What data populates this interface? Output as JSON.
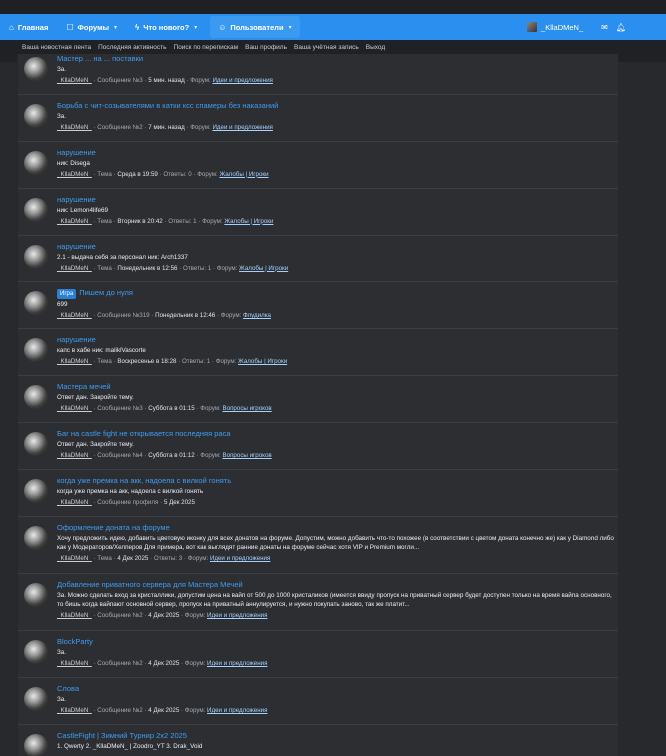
{
  "nav": {
    "home": "Главная",
    "forums": "Форумы",
    "whats_new": "Что нового?",
    "users": "Пользователи",
    "username": "_KllaDMeN_"
  },
  "icons": {
    "home": "home-icon",
    "forums": "forums-icon",
    "whats_new": "whats-new-icon",
    "users": "users-icon",
    "mail": "mail-icon",
    "bell": "bell-icon"
  },
  "subnav": [
    "Ваша новостная лента",
    "Последняя активность",
    "Поиск по перепискам",
    "Ваш профиль",
    "Ваша учётная запись",
    "Выход"
  ],
  "results": [
    {
      "title": "Мастер ... на ... поставки",
      "badge": "",
      "snippet": "За.",
      "author": "_KllaDMeN_",
      "type": "Сообщение №3",
      "date": "5 мин. назад",
      "answers": "",
      "forum": "Идеи и предложения"
    },
    {
      "title": "Борьба с чит-созывателями в катки ксс спамеры без наказаний",
      "badge": "",
      "snippet": "За.",
      "author": "_KllaDMeN_",
      "type": "Сообщение №2",
      "date": "7 мин. назад",
      "answers": "",
      "forum": "Идеи и предложения"
    },
    {
      "title": "нарушение",
      "badge": "",
      "snippet": "ник: Disega",
      "author": "_KllaDMeN_",
      "type": "Тема",
      "date": "Среда в 19:59",
      "answers": "Ответы: 0",
      "forum": "Жалобы | Игроки"
    },
    {
      "title": "нарушение",
      "badge": "",
      "snippet": "ник: Lemon4life69",
      "author": "_KllaDMeN_",
      "type": "Тема",
      "date": "Вторник в 20:42",
      "answers": "Ответы: 1",
      "forum": "Жалобы | Игроки"
    },
    {
      "title": "нарушение",
      "badge": "",
      "snippet": "2.1 - выдача себя за персонал ник: Arch1337",
      "author": "_KllaDMeN_",
      "type": "Тема",
      "date": "Понедельник в 12:56",
      "answers": "Ответы: 1",
      "forum": "Жалобы | Игроки"
    },
    {
      "title": "Пишем до нуля",
      "badge": "Игра",
      "snippet": "699",
      "author": "_KllaDMeN_",
      "type": "Сообщение №319",
      "date": "Понедельник в 12:46",
      "answers": "",
      "forum": "Флудилка"
    },
    {
      "title": "нарушение",
      "badge": "",
      "snippet": "капс в хабе ник: maliklVascorte",
      "author": "_KllaDMeN_",
      "type": "Тема",
      "date": "Воскресенье в 18:28",
      "answers": "Ответы: 1",
      "forum": "Жалобы | Игроки"
    },
    {
      "title": "Мастера мечей",
      "badge": "",
      "snippet": "Ответ дан. Закройте тему.",
      "author": "_KllaDMeN_",
      "type": "Сообщение №3",
      "date": "Суббота в 01:15",
      "answers": "",
      "forum": "Вопросы игроков"
    },
    {
      "title": "Баг на castle fight не открывается последняя раса",
      "badge": "",
      "snippet": "Ответ дан. Закройте тему.",
      "author": "_KllaDMeN_",
      "type": "Сообщение №4",
      "date": "Суббота в 01:12",
      "answers": "",
      "forum": "Вопросы игроков"
    },
    {
      "title": "когда уже премка на акк, надоела с вилкой гонять",
      "badge": "",
      "snippet": "когда уже премка на акк, надоела с вилкой гонять",
      "author": "_KllaDMeN_",
      "type": "Сообщение профиля",
      "date": "5 Дек 2025",
      "answers": "",
      "forum": ""
    },
    {
      "title": "Оформление доната на форуме",
      "badge": "",
      "snippet": "Хочу предложить идею, добавить цветовую иконку для всех донатов на форуме. Допустим, можно добавить что-то похожее (в соответствии с цветом доната конечно же) как у Diamond либо как у Модераторов/Хелперов Для примера, вот как выглядят ранние донаты на форуме сейчас хотя VIP и Premium могли...",
      "author": "_KllaDMeN_",
      "type": "Тема",
      "date": "4 Дек 2025",
      "answers": "Ответы: 3",
      "forum": "Идеи и предложения"
    },
    {
      "title": "Добавление приватного сервера для Мастера Мечей",
      "badge": "",
      "snippet": "За. Можно сделать вход за кристаллики, допустим цена на вайп от 500 до 1000 кристаликов (имеется ввиду пропуск на приватный сервер будет доступен только на время вайпа основного, то бишь когда вайпают основной сервер, пропуск на приватный аннулируется, и нужно покупать заново, так же платит...",
      "author": "_KllaDMeN_",
      "type": "Сообщение №2",
      "date": "4 Дек 2025",
      "answers": "",
      "forum": "Идеи и предложения"
    },
    {
      "title": "BlockParty",
      "badge": "",
      "snippet": "За.",
      "author": "_KllaDMeN_",
      "type": "Сообщение №2",
      "date": "4 Дек 2025",
      "answers": "",
      "forum": "Идеи и предложения"
    },
    {
      "title": "Слова",
      "badge": "",
      "snippet": "За.",
      "author": "_KllaDMeN_",
      "type": "Сообщение №2",
      "date": "4 Дек 2025",
      "answers": "",
      "forum": "Идеи и предложения"
    },
    {
      "title": "CastleFight | Зимний Турнир 2x2 2025",
      "badge": "",
      "snippet": "1. Qwerty 2. _KllaDMeN_ | Zoodro_YT 3. Drak_Void",
      "author": "",
      "type": "",
      "date": "",
      "answers": "",
      "forum": ""
    }
  ],
  "labels": {
    "forum_prefix": "Форум:",
    "sep": "·"
  }
}
